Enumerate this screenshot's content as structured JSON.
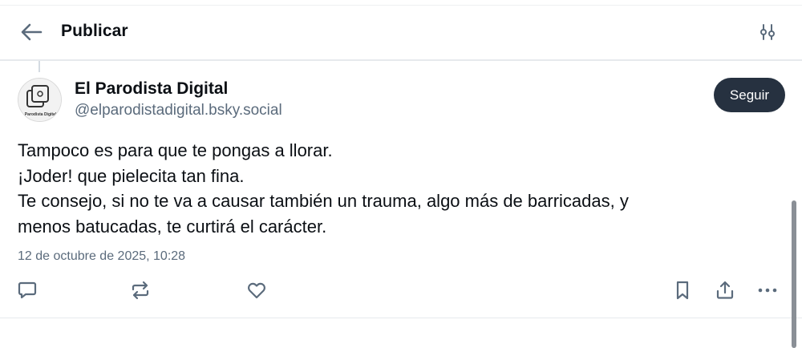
{
  "header": {
    "title": "Publicar",
    "back_icon": "arrow-left-icon",
    "filter_icon": "sliders-icon"
  },
  "post": {
    "author": {
      "name": "El Parodista Digital",
      "handle": "@elparodistadigital.bsky.social",
      "avatar_caption": "Parodista Digital"
    },
    "follow_label": "Seguir",
    "text_lines": [
      "Tampoco es para que te pongas a llorar.",
      "¡Joder! que pielecita tan fina.",
      "Te consejo, si no te va a causar también un trauma, algo más de barricadas, y",
      "menos batucadas, te curtirá el carácter."
    ],
    "date": "12 de octubre de 2025, 10:28",
    "actions": [
      "reply-icon",
      "repost-icon",
      "like-icon",
      "bookmark-icon",
      "share-icon",
      "more-icon"
    ]
  },
  "colors": {
    "icon": "#5b6b7c",
    "follow_button_bg": "#263140",
    "text": "#0b0f14",
    "muted": "#5b6b7c"
  }
}
